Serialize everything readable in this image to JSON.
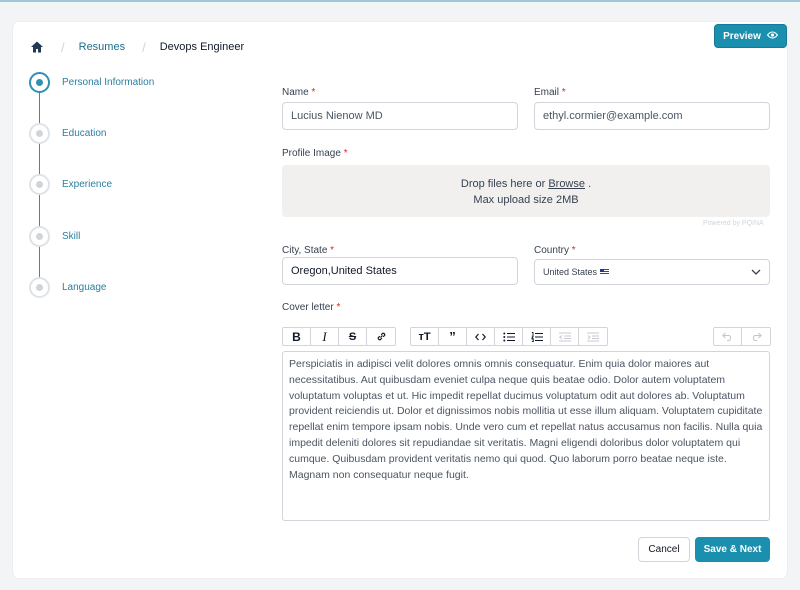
{
  "breadcrumb": {
    "home_icon": "home-icon",
    "items": [
      "Resumes",
      "Devops Engineer"
    ]
  },
  "header": {
    "preview_label": "Preview",
    "preview_icon": "eye-icon"
  },
  "stepper": {
    "steps": [
      {
        "label": "Personal Information",
        "active": true
      },
      {
        "label": "Education",
        "active": false
      },
      {
        "label": "Experience",
        "active": false
      },
      {
        "label": "Skill",
        "active": false
      },
      {
        "label": "Language",
        "active": false
      }
    ]
  },
  "form": {
    "required_mark": "*",
    "name": {
      "label": "Name",
      "value": "Lucius Nienow MD"
    },
    "email": {
      "label": "Email",
      "value": "ethyl.cormier@example.com"
    },
    "profile_image": {
      "label": "Profile Image",
      "drop_prefix": "Drop files here or",
      "browse": "Browse",
      "drop_suffix": ".",
      "max_size": "Max upload size 2MB",
      "powered_by": "Powered by PQINA"
    },
    "city": {
      "label": "City, State",
      "value": "Oregon,United States"
    },
    "country": {
      "label": "Country",
      "value": "United States"
    },
    "cover_letter": {
      "label": "Cover letter",
      "text": "Perspiciatis in adipisci velit dolores omnis omnis consequatur. Enim quia dolor maiores aut necessitatibus. Aut quibusdam eveniet culpa neque quis beatae odio. Dolor autem voluptatem voluptatum voluptas et ut. Hic impedit repellat ducimus voluptatum odit aut dolores ab. Voluptatum provident reiciendis ut. Dolor et dignissimos nobis mollitia ut esse illum aliquam. Voluptatem cupiditate repellat enim tempore ipsam nobis. Unde vero cum et repellat natus accusamus non facilis. Nulla quia impedit deleniti dolores sit repudiandae sit veritatis. Magni eligendi doloribus dolor voluptatem qui cumque. Quibusdam provident veritatis nemo qui quod. Quo laborum porro beatae neque iste. Magnam non consequatur neque fugit."
    }
  },
  "toolbar": {
    "group1": [
      "bold-icon",
      "italic-icon",
      "strikethrough-icon",
      "link-icon"
    ],
    "group2": [
      "heading-icon",
      "quote-icon",
      "code-icon",
      "bullet-list-icon",
      "numbered-list-icon",
      "outdent-icon",
      "indent-icon"
    ],
    "group3": [
      "undo-icon",
      "redo-icon"
    ]
  },
  "actions": {
    "cancel": "Cancel",
    "save_next": "Save & Next"
  },
  "colors": {
    "accent": "#1b8fae",
    "required": "#dc2626"
  }
}
